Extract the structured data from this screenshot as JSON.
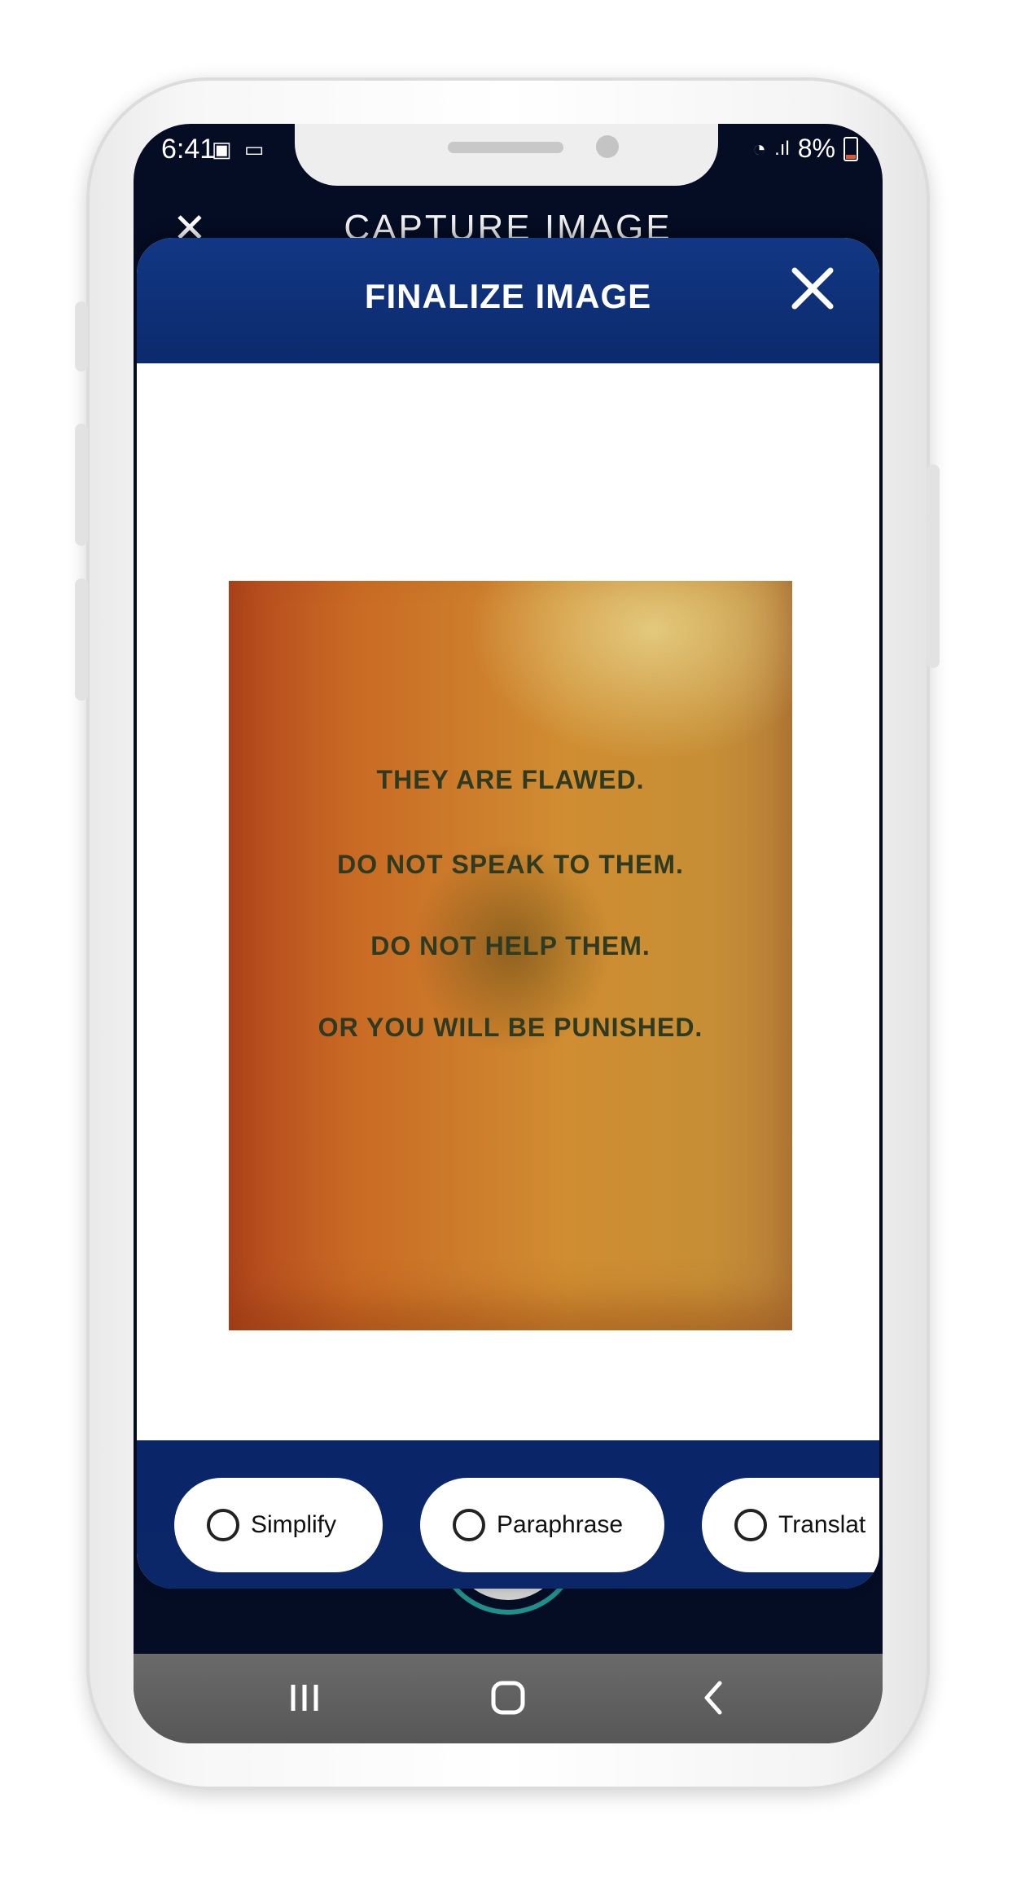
{
  "status_bar": {
    "time": "6:41",
    "battery": "8%"
  },
  "background_screen": {
    "title": "CAPTURE IMAGE",
    "close_icon": "close-icon"
  },
  "modal": {
    "title": "FINALIZE IMAGE",
    "close_icon": "close-icon"
  },
  "photo": {
    "lines": [
      "THEY ARE FLAWED.",
      "DO NOT SPEAK TO THEM.",
      "DO NOT HELP THEM.",
      "OR YOU WILL BE PUNISHED."
    ]
  },
  "options": [
    {
      "label": "Simplify",
      "selected": false
    },
    {
      "label": "Paraphrase",
      "selected": false
    },
    {
      "label": "Translat",
      "selected": false
    }
  ],
  "tools": {
    "rotate_icon": "rotate-icon",
    "crop_icon": "crop-icon",
    "confirm_icon": "checkmark-icon"
  },
  "nav": {
    "recents_icon": "recents-icon",
    "home_icon": "home-icon",
    "back_icon": "back-icon"
  },
  "colors": {
    "header_blue": "#0c2a6d",
    "screen_dark": "#050d25",
    "accent_teal": "#1f8f8a"
  }
}
